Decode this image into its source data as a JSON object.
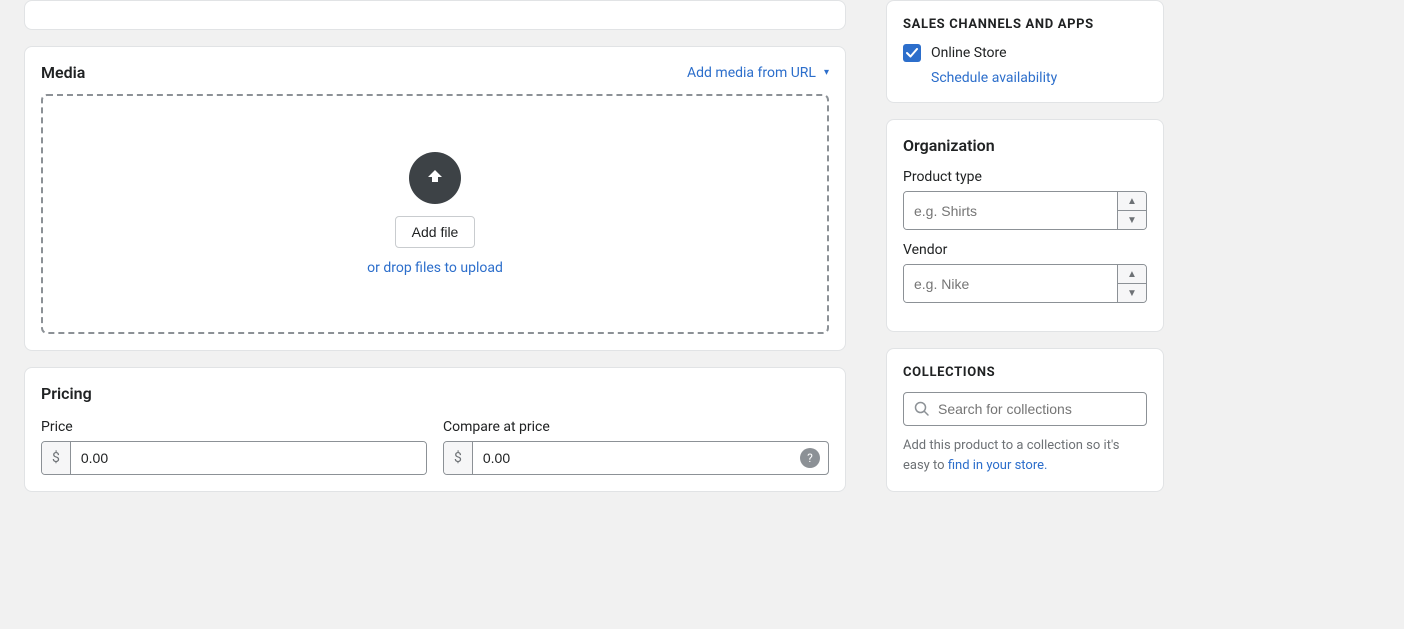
{
  "left": {
    "topCard": {},
    "mediaCard": {
      "title": "Media",
      "addMediaLabel": "Add media from URL",
      "addFileLabel": "Add file",
      "dropText": "or drop files to upload"
    },
    "pricingCard": {
      "title": "Pricing",
      "priceField": {
        "label": "Price",
        "currency": "$",
        "value": "0.00"
      },
      "compareField": {
        "label": "Compare at price",
        "currency": "$",
        "value": "0.00"
      }
    }
  },
  "right": {
    "salesChannels": {
      "sectionTitle": "SALES CHANNELS AND APPS",
      "channels": [
        {
          "name": "Online Store",
          "checked": true
        }
      ],
      "scheduleLabel": "Schedule availability"
    },
    "organization": {
      "sectionTitle": "Organization",
      "productType": {
        "label": "Product type",
        "placeholder": "e.g. Shirts"
      },
      "vendor": {
        "label": "Vendor",
        "placeholder": "e.g. Nike"
      }
    },
    "collections": {
      "sectionTitle": "COLLECTIONS",
      "searchPlaceholder": "Search for collections",
      "descriptionText": "Add this product to a collection so it's easy to",
      "linkText": "find in your store."
    }
  }
}
